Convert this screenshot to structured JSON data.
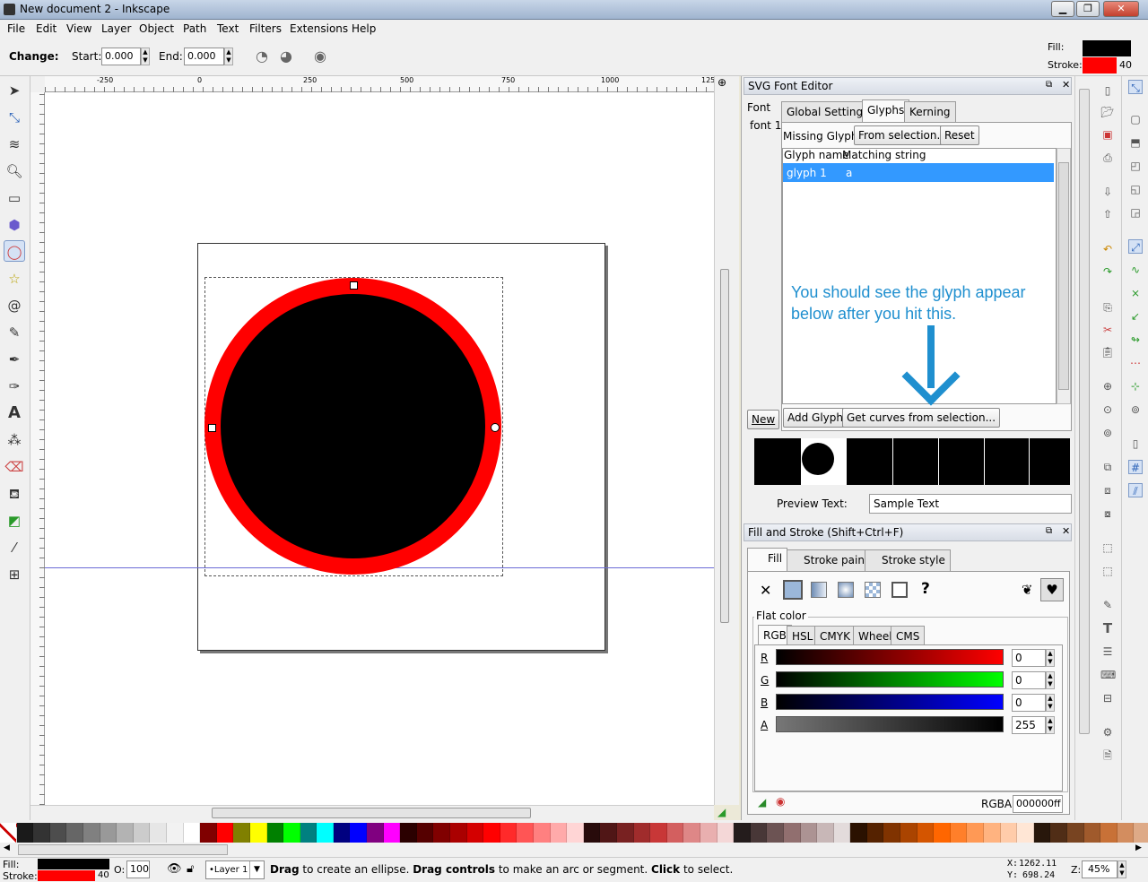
{
  "window": {
    "title": "New document 2 - Inkscape",
    "minimize": "▁",
    "maximize": "❐",
    "close": "✕"
  },
  "menu": [
    "File",
    "Edit",
    "View",
    "Layer",
    "Object",
    "Path",
    "Text",
    "Filters",
    "Extensions",
    "Help"
  ],
  "controls": {
    "change_label": "Change:",
    "start_label": "Start:",
    "start_value": "0.000",
    "end_label": "End:",
    "end_value": "0.000"
  },
  "style_indicator": {
    "fill_label": "Fill:",
    "stroke_label": "Stroke:",
    "stroke_width": "40",
    "fill_color": "#000000",
    "stroke_color": "#ff0000"
  },
  "ruler": {
    "h_ticks": [
      "-250",
      "0",
      "250",
      "500",
      "750",
      "1000",
      "125"
    ]
  },
  "canvas": {
    "ellipse_fill": "#000000",
    "ellipse_stroke": "#ff0000"
  },
  "font_editor": {
    "title": "SVG Font Editor",
    "font_header": "Font",
    "fonts": [
      "font 1"
    ],
    "tabs": [
      "Global Settings",
      "Glyphs",
      "Kerning"
    ],
    "active_tab": "Glyphs",
    "missing_glyph_label": "Missing Glyph:",
    "from_selection": "From selection...",
    "reset": "Reset",
    "col_name": "Glyph name",
    "col_match": "Matching string",
    "glyphs": [
      {
        "name": "glyph 1",
        "match": "a"
      }
    ],
    "annotation": "You should see the glyph appear below after you hit this.",
    "new_button": "New",
    "add_glyph": "Add Glyph",
    "get_curves": "Get curves from selection...",
    "preview_label": "Preview Text:",
    "preview_value": "Sample Text"
  },
  "fill_stroke": {
    "title": "Fill and Stroke (Shift+Ctrl+F)",
    "tabs": [
      "Fill",
      "Stroke paint",
      "Stroke style"
    ],
    "active_tab": "Fill",
    "paint_x": "✕",
    "paint_unset": "?",
    "flat_color_label": "Flat color",
    "mode_tabs": [
      "RGB",
      "HSL",
      "CMYK",
      "Wheel",
      "CMS"
    ],
    "active_mode": "RGB",
    "channels": [
      {
        "label": "R",
        "value": "0",
        "color": "#ff0000"
      },
      {
        "label": "G",
        "value": "0",
        "color": "#00ff00"
      },
      {
        "label": "B",
        "value": "0",
        "color": "#0000ff"
      },
      {
        "label": "A",
        "value": "255",
        "color": "#000000"
      }
    ],
    "rgba_label": "RGBA:",
    "rgba_value": "000000ff"
  },
  "palette": [
    "#ffffff",
    "#1a1a1a",
    "#333333",
    "#4d4d4d",
    "#666666",
    "#808080",
    "#999999",
    "#b3b3b3",
    "#cccccc",
    "#e6e6e6",
    "#f2f2f2",
    "#ffffff",
    "#800000",
    "#ff0000",
    "#808000",
    "#ffff00",
    "#008000",
    "#00ff00",
    "#008080",
    "#00ffff",
    "#000080",
    "#0000ff",
    "#800080",
    "#ff00ff",
    "#2b0000",
    "#550000",
    "#800000",
    "#aa0000",
    "#d40000",
    "#ff0000",
    "#ff2a2a",
    "#ff5555",
    "#ff8080",
    "#ffaaaa",
    "#ffd5d5",
    "#280b0b",
    "#501616",
    "#782121",
    "#a02c2c",
    "#c83737",
    "#d35f5f",
    "#de8787",
    "#e9afaf",
    "#f4d7d7",
    "#241c1c",
    "#483737",
    "#6c5353",
    "#916f6f",
    "#ac9393",
    "#c8b7b7",
    "#e3dbdb",
    "#2b1100",
    "#552200",
    "#803300",
    "#aa4400",
    "#d45500",
    "#ff6600",
    "#ff7f2a",
    "#ff9955",
    "#ffb380",
    "#ffccaa",
    "#ffe6d5",
    "#28170b",
    "#502d16",
    "#784421",
    "#a05a2c",
    "#c87137",
    "#d38d5f",
    "#deaa87",
    "#e9c6af"
  ],
  "status": {
    "fill_label": "Fill:",
    "stroke_label": "Stroke:",
    "stroke_width": "40",
    "opacity_label": "O:",
    "opacity_value": "100",
    "layer": "•Layer 1",
    "hint_b1": "Drag",
    "hint_t1": " to create an ellipse. ",
    "hint_b2": "Drag controls",
    "hint_t2": " to make an arc or segment. ",
    "hint_b3": "Click",
    "hint_t3": " to select.",
    "x_label": "X:",
    "x_value": "1262.11",
    "y_label": "Y:",
    "y_value": "698.24",
    "zoom_label": "Z:",
    "zoom_value": "45%"
  }
}
